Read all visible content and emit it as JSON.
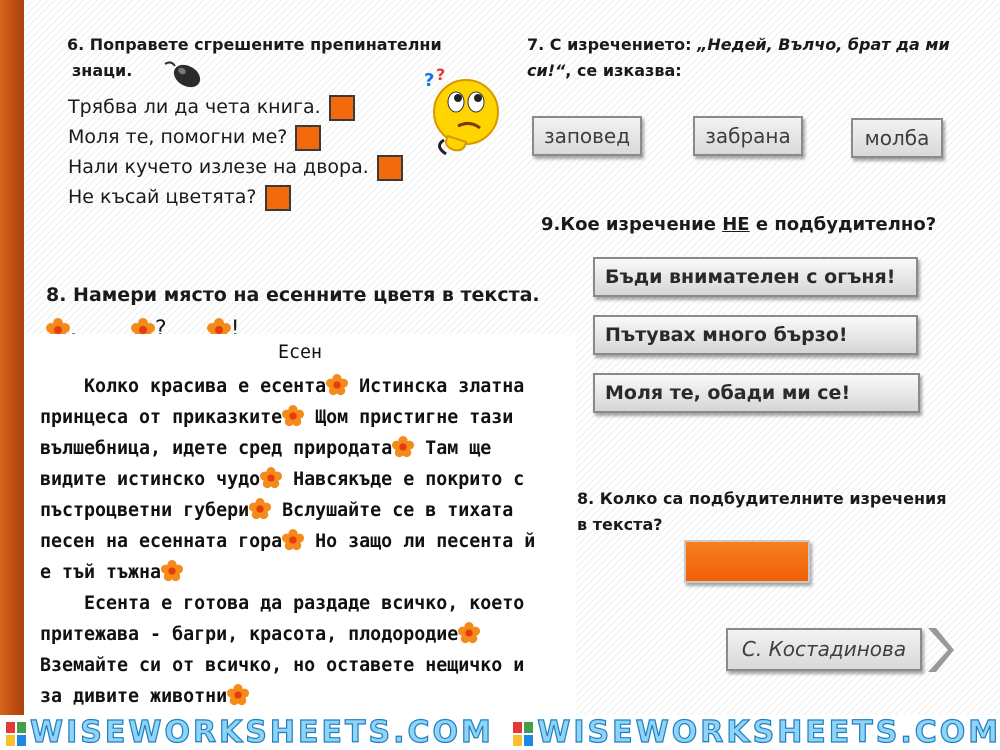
{
  "q6": {
    "title": "6. Поправете сгрешените препинателни",
    "title2": "знаци.",
    "sentences": [
      "Трябва ли да чета книга.",
      "Моля те, помогни ме?",
      "Нали кучето излезе на двора.",
      "Не късай цветята?"
    ]
  },
  "q7": {
    "title_start": "7. С изречението:",
    "quote_line1": "„Недей, Вълчо, брат да ми",
    "quote_line2": "си!“",
    "title_end": ", се изказва:",
    "options": [
      "заповед",
      "забрана",
      "молба"
    ]
  },
  "q9": {
    "title_start": "9.Кое изречение",
    "title_neg": "НЕ",
    "title_end": "е подбудително?",
    "options": [
      "Бъди внимателен с огъня!",
      "Пътувах много бързо!",
      "Моля те, обади ми се!"
    ]
  },
  "q8a": {
    "title": "8. Намери място на есенните цветя в текста.",
    "marks": [
      ".",
      "?",
      "!"
    ]
  },
  "story": {
    "title": "Есен",
    "lines": [
      "    Колко красива е есента",
      " Истинска златна",
      "принцеса от приказките",
      " Щом пристигне тази",
      "вълшебница, идете сред природата",
      " Там ще",
      "видите истинско чудо",
      " Навсякъде е покрито с",
      "пъстроцветни губери",
      " Вслушайте се в тихата",
      "песен на есенната гора",
      " Но защо ли песента й",
      "е тъй тъжна",
      "    Есента е готова да раздаде всичко, което",
      "притежава - багри, красота, плодородие",
      "Вземайте си от всичко, но оставете нещичко и",
      "за дивите животни"
    ]
  },
  "q8b": {
    "title": "8. Колко са подбудителните изречения",
    "title2": "в текста?"
  },
  "author": "С. Костадинова",
  "footer": {
    "text1": "WISEWORKSHEETS.COM",
    "text2": "WISEWORKSHEETS.COM"
  },
  "colors": {
    "accent": "#f26a0c",
    "sidebar": "#c04f10",
    "button_gray": "#d9d9d9"
  }
}
